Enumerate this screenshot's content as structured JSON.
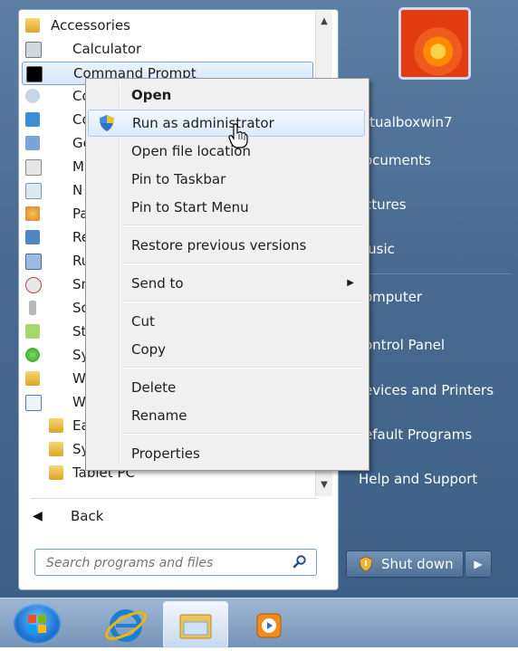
{
  "programs": [
    {
      "label": "Accessories",
      "icon": "folder-icon"
    },
    {
      "label": "Calculator",
      "icon": "calculator-icon"
    },
    {
      "label": "Command Prompt",
      "icon": "command-prompt-icon"
    },
    {
      "label": "Co",
      "icon": "connect-icon"
    },
    {
      "label": "Co",
      "icon": "computer-icon"
    },
    {
      "label": "Ge",
      "icon": "getting-started-icon"
    },
    {
      "label": "M",
      "icon": "math-input-icon"
    },
    {
      "label": "N",
      "icon": "notepad-icon"
    },
    {
      "label": "Pa",
      "icon": "paint-icon"
    },
    {
      "label": "Re",
      "icon": "remote-desktop-icon"
    },
    {
      "label": "Ru",
      "icon": "run-icon"
    },
    {
      "label": "Sn",
      "icon": "snipping-tool-icon"
    },
    {
      "label": "So",
      "icon": "sound-recorder-icon"
    },
    {
      "label": "St",
      "icon": "sticky-notes-icon"
    },
    {
      "label": "Sy",
      "icon": "sync-center-icon"
    },
    {
      "label": "W",
      "icon": "windows-explorer-icon"
    },
    {
      "label": "W",
      "icon": "wordpad-icon"
    },
    {
      "label": "Ea",
      "icon": "folder-icon"
    },
    {
      "label": "Sy",
      "icon": "folder-icon"
    },
    {
      "label": "Tablet PC",
      "icon": "folder-icon"
    }
  ],
  "back_label": "Back",
  "search": {
    "placeholder": "Search programs and files"
  },
  "right_links": [
    "rtualboxwin7",
    "ocuments",
    "ctures",
    "lusic",
    "omputer",
    "ontrol Panel",
    "evices and Printers",
    "efault Programs",
    "Help and Support"
  ],
  "shutdown_label": "Shut down",
  "context_menu": [
    {
      "label": "Open",
      "bold": true
    },
    {
      "label": "Run as administrator",
      "icon": "uac-shield-icon"
    },
    {
      "label": "Open file location"
    },
    {
      "label": "Pin to Taskbar"
    },
    {
      "label": "Pin to Start Menu"
    },
    {
      "label": "Restore previous versions"
    },
    {
      "label": "Send to",
      "submenu": true
    },
    {
      "label": "Cut"
    },
    {
      "label": "Copy"
    },
    {
      "label": "Delete"
    },
    {
      "label": "Rename"
    },
    {
      "label": "Properties"
    }
  ],
  "colors": {
    "accent": "#3d6b9e",
    "selection": "#d6e8fb",
    "menu_bg": "#f0f0f0"
  }
}
